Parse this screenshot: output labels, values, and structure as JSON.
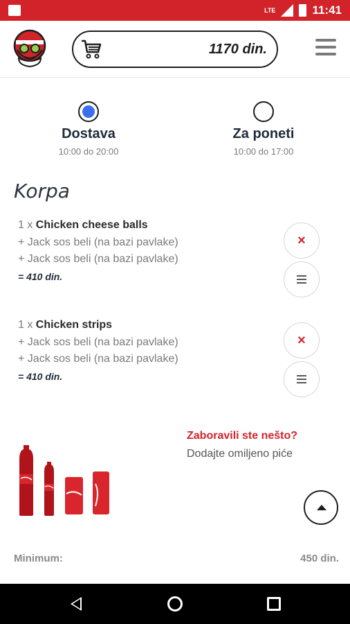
{
  "status_bar": {
    "time": "11:41",
    "network": "LTE"
  },
  "header": {
    "cart_total": "1170 din.",
    "icons": {
      "logo": "mascot-logo",
      "cart": "shopping-cart-icon",
      "menu": "hamburger-menu-icon"
    }
  },
  "delivery_options": [
    {
      "name": "Dostava",
      "hours": "10:00 do 20:00",
      "selected": true
    },
    {
      "name": "Za poneti",
      "hours": "10:00 do 17:00",
      "selected": false
    }
  ],
  "cart": {
    "title": "Korpa",
    "items": [
      {
        "qty": "1 x ",
        "name": "Chicken cheese balls",
        "extras": [
          "+ Jack sos beli (na bazi pavlake)",
          "+ Jack sos beli (na bazi pavlake)"
        ],
        "price": "= 410 din."
      },
      {
        "qty": "1 x ",
        "name": "Chicken strips",
        "extras": [
          "+ Jack sos beli (na bazi pavlake)",
          "+ Jack sos beli (na bazi pavlake)"
        ],
        "price": "= 410 din."
      }
    ]
  },
  "upsell": {
    "title": "Zaboravili ste nešto?",
    "subtitle": "Dodajte omiljeno piće"
  },
  "summary": {
    "minimum_label": "Minimum:",
    "minimum_value": "450 din."
  },
  "colors": {
    "brand_red": "#d2232a",
    "radio_blue": "#3d6ef0",
    "text_dark": "#1e2a3a"
  }
}
